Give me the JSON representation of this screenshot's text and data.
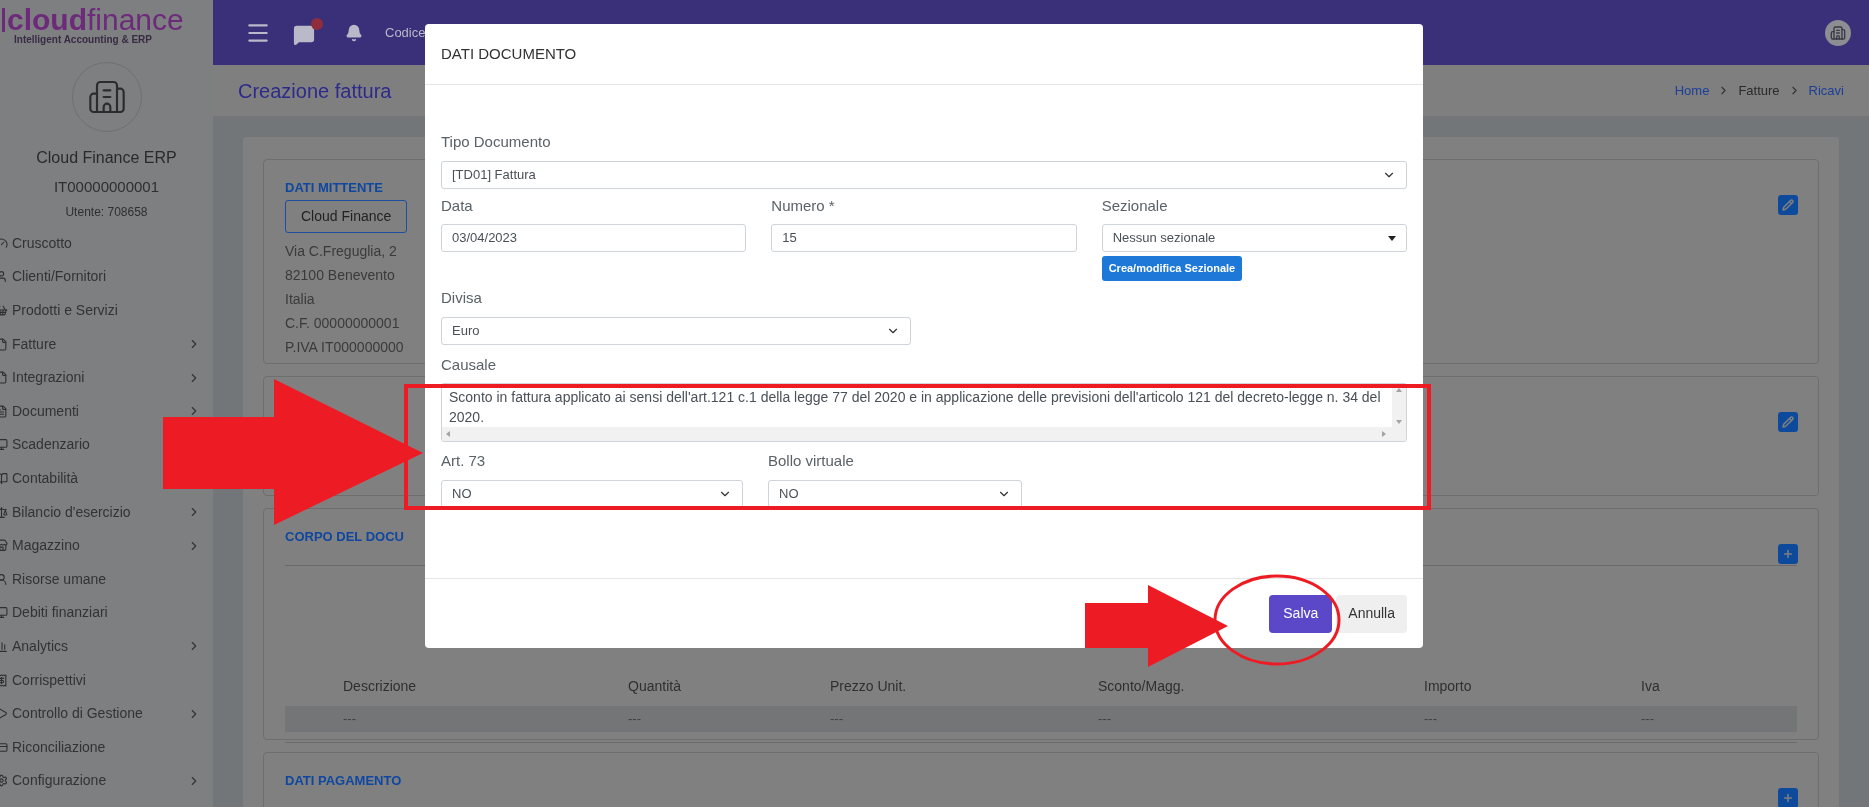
{
  "brand": {
    "name_bold": "cloud",
    "name_light": "finance",
    "tagline": "Intelligent Accounting & ERP"
  },
  "company": {
    "name": "Cloud Finance ERP",
    "vat": "IT00000000001",
    "user": "Utente: 708658"
  },
  "sidebar": {
    "items": [
      {
        "label": "Cruscotto",
        "expandable": false
      },
      {
        "label": "Clienti/Fornitori",
        "expandable": false
      },
      {
        "label": "Prodotti e Servizi",
        "expandable": false
      },
      {
        "label": "Fatture",
        "expandable": true
      },
      {
        "label": "Integrazioni",
        "expandable": true
      },
      {
        "label": "Documenti",
        "expandable": true
      },
      {
        "label": "Scadenzario",
        "expandable": false
      },
      {
        "label": "Contabilità",
        "expandable": false
      },
      {
        "label": "Bilancio d'esercizio",
        "expandable": true
      },
      {
        "label": "Magazzino",
        "expandable": true
      },
      {
        "label": "Risorse umane",
        "expandable": false
      },
      {
        "label": "Debiti finanziari",
        "expandable": false
      },
      {
        "label": "Analytics",
        "expandable": true
      },
      {
        "label": "Corrispettivi",
        "expandable": false
      },
      {
        "label": "Controllo di Gestione",
        "expandable": true
      },
      {
        "label": "Riconciliazione",
        "expandable": false
      },
      {
        "label": "Configurazione",
        "expandable": true
      }
    ]
  },
  "topbar": {
    "text": "Codice"
  },
  "page": {
    "title": "Creazione fattura",
    "breadcrumb": [
      {
        "label": "Home",
        "link": true
      },
      {
        "label": "Fatture",
        "link": false
      },
      {
        "label": "Ricavi",
        "link": true
      }
    ]
  },
  "cards": [
    {
      "title": "DATI MITTENTE",
      "button": "Cloud Finance",
      "lines": [
        "Via C.Freguglia, 2",
        "82100 Benevento",
        "Italia",
        "C.F. 00000000001",
        "P.IVA IT000000000"
      ],
      "kind": "edit"
    },
    {
      "kind": "edit"
    },
    {
      "title": "CORPO DEL DOCU",
      "kind": "add",
      "table": {
        "columns": [
          "Descrizione",
          "Quantità",
          "Prezzo Unit.",
          "Sconto/Magg.",
          "Importo",
          "Iva"
        ],
        "rows": [
          [
            "---",
            "---",
            "---",
            "---",
            "---",
            "---"
          ]
        ]
      }
    },
    {
      "title": "DATI PAGAMENTO",
      "kind": "add"
    }
  ],
  "modal": {
    "title": "DATI DOCUMENTO",
    "rows": [
      [
        {
          "kind": "select",
          "label": "Tipo Documento",
          "value": "[TD01] Fattura"
        }
      ],
      [
        {
          "kind": "input",
          "label": "Data",
          "value": "03/04/2023"
        },
        {
          "kind": "input",
          "label": "Numero *",
          "value": "15"
        },
        {
          "kind": "dropdown",
          "label": "Sezionale",
          "value": "Nessun sezionale",
          "button": "Crea/modifica Sezionale"
        }
      ],
      [
        {
          "kind": "select",
          "label": "Divisa",
          "value": "Euro"
        }
      ],
      [
        {
          "kind": "textarea",
          "label": "Causale",
          "value": "Sconto in fattura applicato ai sensi dell'art.121 c.1 della legge 77 del 2020 e in applicazione delle previsioni dell'articolo 121 del decreto-legge n. 34 del 2020."
        }
      ],
      [
        {
          "kind": "select",
          "label": "Art. 73",
          "value": "NO"
        },
        {
          "kind": "select",
          "label": "Bollo virtuale",
          "value": "NO"
        }
      ]
    ],
    "buttons": [
      {
        "label": "Salva",
        "primary": true
      },
      {
        "label": "Annulla",
        "primary": false
      }
    ]
  }
}
